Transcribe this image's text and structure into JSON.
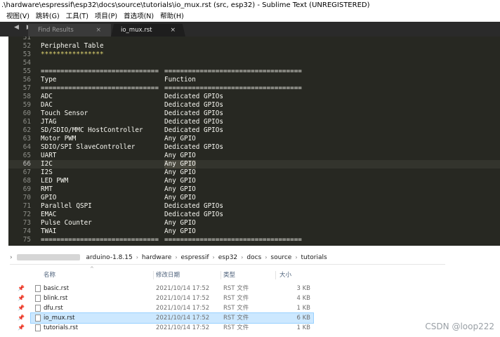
{
  "window": {
    "title": ".\\hardware\\espressif\\esp32\\docs\\source\\tutorials\\io_mux.rst (src, esp32) - Sublime Text (UNREGISTERED)"
  },
  "menu": [
    "视图(V)",
    "跳转(G)",
    "工具(T)",
    "项目(P)",
    "首选项(N)",
    "帮助(H)"
  ],
  "tabs": {
    "arrows": "◀ ▶",
    "inactive_label": "Find Results",
    "active_label": "io_mux.rst",
    "close_glyph": "×"
  },
  "editor": {
    "lines": [
      {
        "n": "51",
        "c1": "",
        "c2": ""
      },
      {
        "n": "52",
        "c1": "Peripheral Table",
        "c2": ""
      },
      {
        "n": "53",
        "c1": "****************",
        "c2": ""
      },
      {
        "n": "54",
        "c1": "",
        "c2": ""
      },
      {
        "n": "55",
        "c1": "==============================",
        "c2": "==================================="
      },
      {
        "n": "56",
        "c1": "Type",
        "c2": "Function"
      },
      {
        "n": "57",
        "c1": "==============================",
        "c2": "==================================="
      },
      {
        "n": "58",
        "c1": "ADC",
        "c2": "Dedicated GPIOs"
      },
      {
        "n": "59",
        "c1": "DAC",
        "c2": "Dedicated GPIOs"
      },
      {
        "n": "60",
        "c1": "Touch Sensor",
        "c2": "Dedicated GPIOs"
      },
      {
        "n": "61",
        "c1": "JTAG",
        "c2": "Dedicated GPIOs"
      },
      {
        "n": "62",
        "c1": "SD/SDIO/MMC HostController",
        "c2": "Dedicated GPIOs"
      },
      {
        "n": "63",
        "c1": "Motor PWM",
        "c2": "Any GPIO"
      },
      {
        "n": "64",
        "c1": "SDIO/SPI SlaveController",
        "c2": "Dedicated GPIOs"
      },
      {
        "n": "65",
        "c1": "UART",
        "c2": "Any GPIO"
      },
      {
        "n": "66",
        "c1": "I2C",
        "c2": "Any GPIO"
      },
      {
        "n": "67",
        "c1": "I2S",
        "c2": "Any GPIO"
      },
      {
        "n": "68",
        "c1": "LED PWM",
        "c2": "Any GPIO"
      },
      {
        "n": "69",
        "c1": "RMT",
        "c2": "Any GPIO"
      },
      {
        "n": "70",
        "c1": "GPIO",
        "c2": "Any GPIO"
      },
      {
        "n": "71",
        "c1": "Parallel QSPI",
        "c2": "Dedicated GPIOs"
      },
      {
        "n": "72",
        "c1": "EMAC",
        "c2": "Dedicated GPIOs"
      },
      {
        "n": "73",
        "c1": "Pulse Counter",
        "c2": "Any GPIO"
      },
      {
        "n": "74",
        "c1": "TWAI",
        "c2": "Any GPIO"
      },
      {
        "n": "75",
        "c1": "==============================",
        "c2": "==================================="
      }
    ]
  },
  "explorer": {
    "breadcrumb": [
      "arduino-1.8.15",
      "hardware",
      "espressif",
      "esp32",
      "docs",
      "source",
      "tutorials"
    ],
    "columns": {
      "name": "名称",
      "date": "修改日期",
      "type": "类型",
      "size": "大小"
    },
    "files": [
      {
        "name": "basic.rst",
        "date": "2021/10/14 17:52",
        "type": "RST 文件",
        "size": "3 KB"
      },
      {
        "name": "blink.rst",
        "date": "2021/10/14 17:52",
        "type": "RST 文件",
        "size": "4 KB"
      },
      {
        "name": "dfu.rst",
        "date": "2021/10/14 17:52",
        "type": "RST 文件",
        "size": "1 KB"
      },
      {
        "name": "io_mux.rst",
        "date": "2021/10/14 17:52",
        "type": "RST 文件",
        "size": "6 KB"
      },
      {
        "name": "tutorials.rst",
        "date": "2021/10/14 17:52",
        "type": "RST 文件",
        "size": "1 KB"
      }
    ]
  },
  "watermark": "CSDN @loop222"
}
